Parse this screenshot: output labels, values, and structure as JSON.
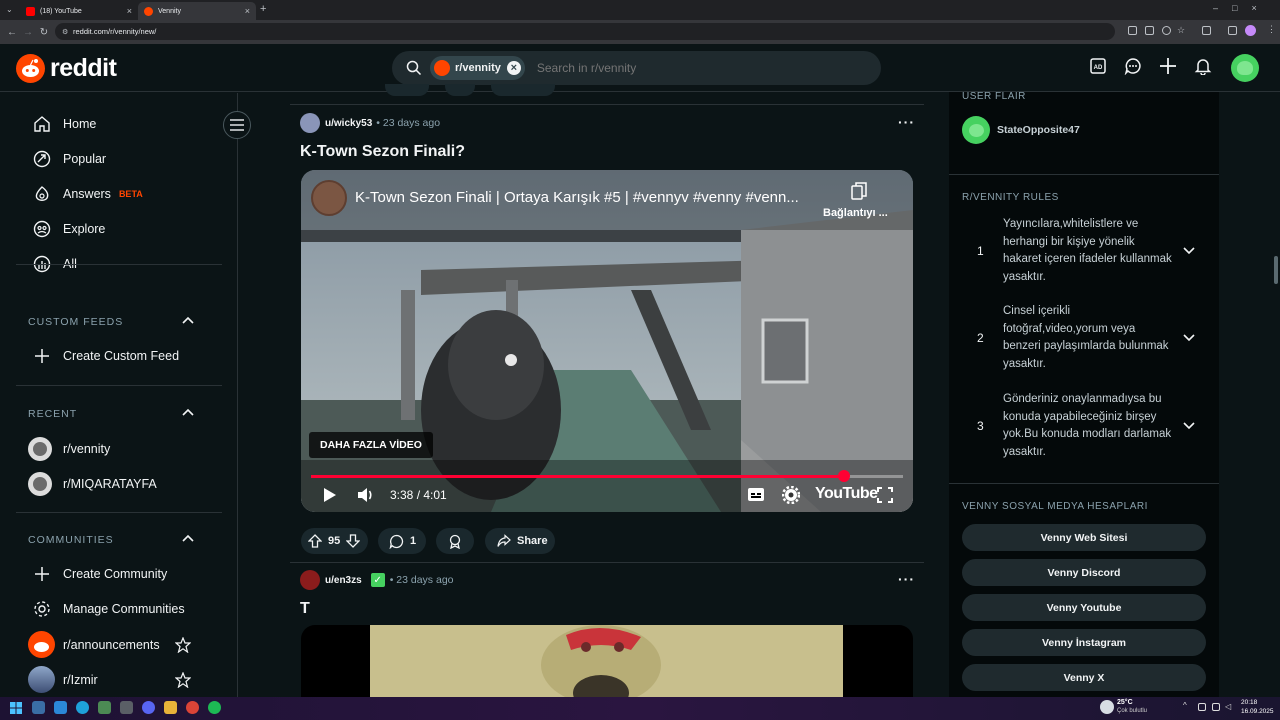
{
  "browser": {
    "tabs": [
      {
        "title": "(18) YouTube",
        "icon": "youtube-icon",
        "active": false
      },
      {
        "title": "Vennity",
        "icon": "reddit-icon",
        "active": true
      }
    ],
    "url": "reddit.com/r/vennity/new/"
  },
  "header": {
    "brand": "reddit",
    "search_chip": "r/vennity",
    "search_placeholder": "Search in r/vennity",
    "icons": [
      "ad-icon",
      "chat-icon",
      "create-icon",
      "notification-icon",
      "avatar"
    ]
  },
  "sidebar": {
    "main": [
      {
        "label": "Home",
        "icon": "home-icon"
      },
      {
        "label": "Popular",
        "icon": "popular-icon"
      },
      {
        "label": "Answers",
        "icon": "answers-icon",
        "badge": "BETA"
      },
      {
        "label": "Explore",
        "icon": "explore-icon"
      },
      {
        "label": "All",
        "icon": "all-icon"
      }
    ],
    "custom_feeds": {
      "heading": "CUSTOM FEEDS",
      "create": "Create Custom Feed"
    },
    "recent": {
      "heading": "RECENT",
      "items": [
        "r/vennity",
        "r/MIQARATAYFA"
      ]
    },
    "communities": {
      "heading": "COMMUNITIES",
      "create": "Create Community",
      "manage": "Manage Communities",
      "items": [
        "r/announcements",
        "r/Izmir"
      ]
    }
  },
  "posts": [
    {
      "author": "u/wicky53",
      "age": "• 23 days ago",
      "title": "K-Town Sezon Finali?",
      "video": {
        "title": "K-Town Sezon Finali | Ortaya Karışık #5 | #vennyv #venny #venn...",
        "copy_link": "Bağlantıyı ...",
        "more_videos": "DAHA FAZLA VİDEO",
        "time": "3:38 / 4:01",
        "progress": 0.9,
        "brand": "YouTube"
      },
      "votes": "95",
      "comments": "1",
      "share": "Share"
    },
    {
      "author": "u/en3zs",
      "age": "• 23 days ago",
      "title": "T"
    }
  ],
  "right": {
    "user_flair_heading": "USER FLAIR",
    "flair_user": "StateOpposite47",
    "rules_heading": "R/VENNITY RULES",
    "rules": [
      {
        "num": "1",
        "text": "Yayıncılara,whitelistlere ve herhangi bir kişiye yönelik hakaret içeren ifadeler kullanmak yasaktır."
      },
      {
        "num": "2",
        "text": "Cinsel içerikli fotoğraf,video,yorum veya benzeri paylaşımlarda bulunmak yasaktır."
      },
      {
        "num": "3",
        "text": "Gönderiniz onaylanmadıysa bu konuda yapabileceğiniz birşey yok.Bu konuda modları darlamak yasaktır."
      }
    ],
    "social_heading": "VENNY SOSYAL MEDYA HESAPLARI",
    "social_buttons": [
      "Venny Web Sitesi",
      "Venny Discord",
      "Venny Youtube",
      "Venny İnstagram",
      "Venny X"
    ]
  },
  "taskbar": {
    "weather_temp": "25°C",
    "weather_desc": "Çok bulutlu",
    "time": "20:18",
    "date": "16.09.2025"
  },
  "colors": {
    "brand": "#ff4500",
    "progress": "#ff0033",
    "bg": "#0b1416"
  }
}
